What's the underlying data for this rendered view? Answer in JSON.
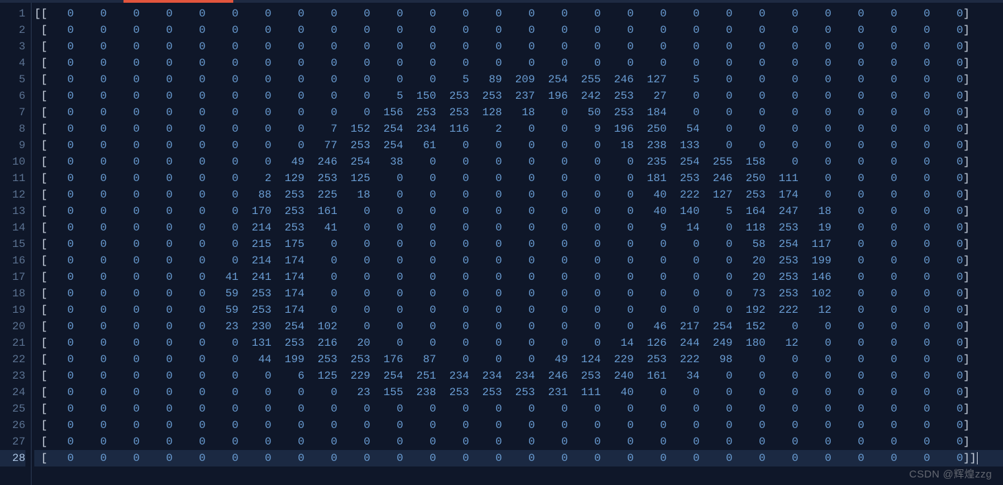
{
  "colors": {
    "background": "#0f1729",
    "gutter_text": "#5b7291",
    "gutter_text_current": "#a8c1e0",
    "number": "#6a9dd3",
    "punctuation": "#cdd6e3",
    "tab_indicator": "#e2553d",
    "current_line_bg": "#1b2942"
  },
  "watermark": "CSDN @辉煌zzg",
  "current_line": 28,
  "matrix": {
    "rows": [
      [
        0,
        0,
        0,
        0,
        0,
        0,
        0,
        0,
        0,
        0,
        0,
        0,
        0,
        0,
        0,
        0,
        0,
        0,
        0,
        0,
        0,
        0,
        0,
        0,
        0,
        0,
        0,
        0
      ],
      [
        0,
        0,
        0,
        0,
        0,
        0,
        0,
        0,
        0,
        0,
        0,
        0,
        0,
        0,
        0,
        0,
        0,
        0,
        0,
        0,
        0,
        0,
        0,
        0,
        0,
        0,
        0,
        0
      ],
      [
        0,
        0,
        0,
        0,
        0,
        0,
        0,
        0,
        0,
        0,
        0,
        0,
        0,
        0,
        0,
        0,
        0,
        0,
        0,
        0,
        0,
        0,
        0,
        0,
        0,
        0,
        0,
        0
      ],
      [
        0,
        0,
        0,
        0,
        0,
        0,
        0,
        0,
        0,
        0,
        0,
        0,
        0,
        0,
        0,
        0,
        0,
        0,
        0,
        0,
        0,
        0,
        0,
        0,
        0,
        0,
        0,
        0
      ],
      [
        0,
        0,
        0,
        0,
        0,
        0,
        0,
        0,
        0,
        0,
        0,
        0,
        5,
        89,
        209,
        254,
        255,
        246,
        127,
        5,
        0,
        0,
        0,
        0,
        0,
        0,
        0,
        0
      ],
      [
        0,
        0,
        0,
        0,
        0,
        0,
        0,
        0,
        0,
        0,
        5,
        150,
        253,
        253,
        237,
        196,
        242,
        253,
        27,
        0,
        0,
        0,
        0,
        0,
        0,
        0,
        0,
        0
      ],
      [
        0,
        0,
        0,
        0,
        0,
        0,
        0,
        0,
        0,
        0,
        156,
        253,
        253,
        128,
        18,
        0,
        50,
        253,
        184,
        0,
        0,
        0,
        0,
        0,
        0,
        0,
        0,
        0
      ],
      [
        0,
        0,
        0,
        0,
        0,
        0,
        0,
        0,
        7,
        152,
        254,
        234,
        116,
        2,
        0,
        0,
        9,
        196,
        250,
        54,
        0,
        0,
        0,
        0,
        0,
        0,
        0,
        0
      ],
      [
        0,
        0,
        0,
        0,
        0,
        0,
        0,
        0,
        77,
        253,
        254,
        61,
        0,
        0,
        0,
        0,
        0,
        18,
        238,
        133,
        0,
        0,
        0,
        0,
        0,
        0,
        0,
        0
      ],
      [
        0,
        0,
        0,
        0,
        0,
        0,
        0,
        49,
        246,
        254,
        38,
        0,
        0,
        0,
        0,
        0,
        0,
        0,
        235,
        254,
        255,
        158,
        0,
        0,
        0,
        0,
        0,
        0
      ],
      [
        0,
        0,
        0,
        0,
        0,
        0,
        2,
        129,
        253,
        125,
        0,
        0,
        0,
        0,
        0,
        0,
        0,
        0,
        181,
        253,
        246,
        250,
        111,
        0,
        0,
        0,
        0,
        0
      ],
      [
        0,
        0,
        0,
        0,
        0,
        0,
        88,
        253,
        225,
        18,
        0,
        0,
        0,
        0,
        0,
        0,
        0,
        0,
        40,
        222,
        127,
        253,
        174,
        0,
        0,
        0,
        0,
        0
      ],
      [
        0,
        0,
        0,
        0,
        0,
        0,
        170,
        253,
        161,
        0,
        0,
        0,
        0,
        0,
        0,
        0,
        0,
        0,
        40,
        140,
        5,
        164,
        247,
        18,
        0,
        0,
        0,
        0
      ],
      [
        0,
        0,
        0,
        0,
        0,
        0,
        214,
        253,
        41,
        0,
        0,
        0,
        0,
        0,
        0,
        0,
        0,
        0,
        9,
        14,
        0,
        118,
        253,
        19,
        0,
        0,
        0,
        0
      ],
      [
        0,
        0,
        0,
        0,
        0,
        0,
        215,
        175,
        0,
        0,
        0,
        0,
        0,
        0,
        0,
        0,
        0,
        0,
        0,
        0,
        0,
        58,
        254,
        117,
        0,
        0,
        0,
        0
      ],
      [
        0,
        0,
        0,
        0,
        0,
        0,
        214,
        174,
        0,
        0,
        0,
        0,
        0,
        0,
        0,
        0,
        0,
        0,
        0,
        0,
        0,
        20,
        253,
        199,
        0,
        0,
        0,
        0
      ],
      [
        0,
        0,
        0,
        0,
        0,
        41,
        241,
        174,
        0,
        0,
        0,
        0,
        0,
        0,
        0,
        0,
        0,
        0,
        0,
        0,
        0,
        20,
        253,
        146,
        0,
        0,
        0,
        0
      ],
      [
        0,
        0,
        0,
        0,
        0,
        59,
        253,
        174,
        0,
        0,
        0,
        0,
        0,
        0,
        0,
        0,
        0,
        0,
        0,
        0,
        0,
        73,
        253,
        102,
        0,
        0,
        0,
        0
      ],
      [
        0,
        0,
        0,
        0,
        0,
        59,
        253,
        174,
        0,
        0,
        0,
        0,
        0,
        0,
        0,
        0,
        0,
        0,
        0,
        0,
        0,
        192,
        222,
        12,
        0,
        0,
        0,
        0
      ],
      [
        0,
        0,
        0,
        0,
        0,
        23,
        230,
        254,
        102,
        0,
        0,
        0,
        0,
        0,
        0,
        0,
        0,
        0,
        46,
        217,
        254,
        152,
        0,
        0,
        0,
        0,
        0,
        0
      ],
      [
        0,
        0,
        0,
        0,
        0,
        0,
        131,
        253,
        216,
        20,
        0,
        0,
        0,
        0,
        0,
        0,
        0,
        14,
        126,
        244,
        249,
        180,
        12,
        0,
        0,
        0,
        0,
        0
      ],
      [
        0,
        0,
        0,
        0,
        0,
        0,
        44,
        199,
        253,
        253,
        176,
        87,
        0,
        0,
        0,
        49,
        124,
        229,
        253,
        222,
        98,
        0,
        0,
        0,
        0,
        0,
        0,
        0
      ],
      [
        0,
        0,
        0,
        0,
        0,
        0,
        0,
        6,
        125,
        229,
        254,
        251,
        234,
        234,
        234,
        246,
        253,
        240,
        161,
        34,
        0,
        0,
        0,
        0,
        0,
        0,
        0,
        0
      ],
      [
        0,
        0,
        0,
        0,
        0,
        0,
        0,
        0,
        0,
        23,
        155,
        238,
        253,
        253,
        253,
        231,
        111,
        40,
        0,
        0,
        0,
        0,
        0,
        0,
        0,
        0,
        0,
        0
      ],
      [
        0,
        0,
        0,
        0,
        0,
        0,
        0,
        0,
        0,
        0,
        0,
        0,
        0,
        0,
        0,
        0,
        0,
        0,
        0,
        0,
        0,
        0,
        0,
        0,
        0,
        0,
        0,
        0
      ],
      [
        0,
        0,
        0,
        0,
        0,
        0,
        0,
        0,
        0,
        0,
        0,
        0,
        0,
        0,
        0,
        0,
        0,
        0,
        0,
        0,
        0,
        0,
        0,
        0,
        0,
        0,
        0,
        0
      ],
      [
        0,
        0,
        0,
        0,
        0,
        0,
        0,
        0,
        0,
        0,
        0,
        0,
        0,
        0,
        0,
        0,
        0,
        0,
        0,
        0,
        0,
        0,
        0,
        0,
        0,
        0,
        0,
        0
      ],
      [
        0,
        0,
        0,
        0,
        0,
        0,
        0,
        0,
        0,
        0,
        0,
        0,
        0,
        0,
        0,
        0,
        0,
        0,
        0,
        0,
        0,
        0,
        0,
        0,
        0,
        0,
        0,
        0
      ]
    ]
  }
}
